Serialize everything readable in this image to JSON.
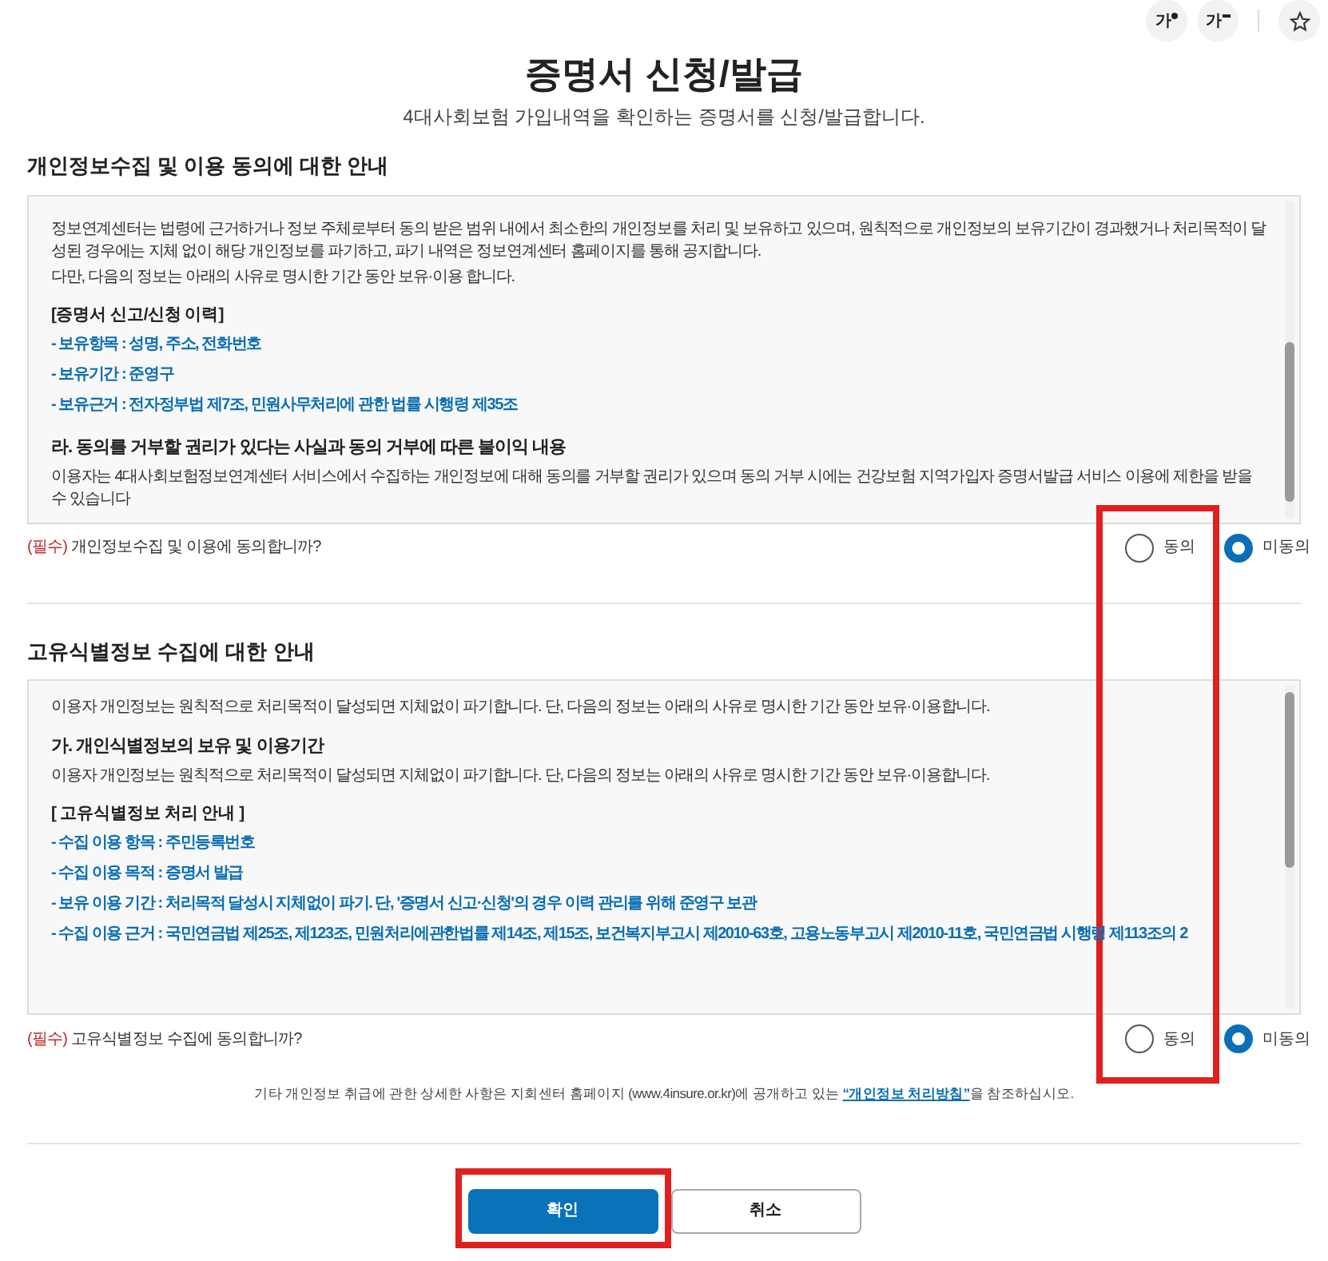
{
  "tools": [
    {
      "label": "가",
      "kind": "font-up"
    },
    {
      "label": "가",
      "kind": "font-down"
    },
    {
      "kind": "favorite"
    }
  ],
  "title": "증명서 신청/발급",
  "subtitle": "4대사회보험 가입내역을 확인하는 증명서를 신청/발급합니다.",
  "sections": [
    {
      "title": "개인정보수집 및 이용 동의에 대한 안내",
      "content": [
        {
          "kind": "para",
          "text": "정보연계센터는 법령에 근거하거나 정보 주체로부터 동의 받은 범위 내에서 최소한의 개인정보를 처리 및 보유하고 있으며, 원칙적으로 개인정보의 보유기간이 경과했거나 처리목적이 달성된 경우에는 지체 없이 해당 개인정보를 파기하고, 파기 내역은 정보연계센터 홈페이지를 통해 공지합니다."
        },
        {
          "kind": "para",
          "text": "다만, 다음의 정보는 아래의 사유로 명시한 기간 동안 보유·이용 합니다."
        },
        {
          "kind": "bracket",
          "text": "[증명서 신고/신청 이력]"
        },
        {
          "kind": "item",
          "text": "- 보유항목 : 성명, 주소, 전화번호"
        },
        {
          "kind": "item",
          "text": "- 보유기간 : 준영구"
        },
        {
          "kind": "item",
          "text": "- 보유근거 : 전자정부법 제7조, 민원사무처리에 관한 법률 시행령 제35조"
        },
        {
          "kind": "heading",
          "text": "라. 동의를 거부할 권리가 있다는 사실과 동의 거부에 따른 불이익 내용"
        },
        {
          "kind": "para",
          "text": "이용자는 4대사회보험정보연계센터 서비스에서 수집하는 개인정보에 대해 동의를 거부할 권리가 있으며 동의 거부 시에는 건강보험 지역가입자 증명서발급 서비스 이용에 제한을 받을 수 있습니다"
        }
      ],
      "required": "(필수)",
      "question": "개인정보수집 및 이용에 동의합니까?",
      "options": [
        {
          "label": "동의",
          "selected": false
        },
        {
          "label": "미동의",
          "selected": true
        }
      ]
    },
    {
      "title": "고유식별정보 수집에 대한 안내",
      "content": [
        {
          "kind": "para",
          "text": "이용자 개인정보는 원칙적으로 처리목적이 달성되면 지체없이 파기합니다. 단, 다음의 정보는 아래의 사유로 명시한 기간 동안 보유·이용합니다."
        },
        {
          "kind": "heading",
          "text": "가. 개인식별정보의 보유 및 이용기간"
        },
        {
          "kind": "para",
          "text": "이용자 개인정보는 원칙적으로 처리목적이 달성되면 지체없이 파기합니다. 단, 다음의 정보는 아래의 사유로 명시한 기간 동안 보유·이용합니다."
        },
        {
          "kind": "bracket",
          "text": "[ 고유식별정보 처리 안내 ]"
        },
        {
          "kind": "item",
          "text": "- 수집 이용 항목 : 주민등록번호"
        },
        {
          "kind": "item",
          "text": "- 수집 이용 목적 : 증명서 발급"
        },
        {
          "kind": "item",
          "text": "- 보유 이용 기간 : 처리목적 달성시 지체없이 파기. 단, '증명서 신고·신청'의 경우 이력 관리를 위해 준영구 보관"
        },
        {
          "kind": "item",
          "text": "- 수집 이용 근거 : 국민연금법 제25조, 제123조, 민원처리에관한법률 제14조, 제15조, 보건복지부고시 제2010-63호, 고용노동부고시 제2010-11호, 국민연금법 시행령 제113조의 2"
        }
      ],
      "required": "(필수)",
      "question": "고유식별정보 수집에 동의합니까?",
      "options": [
        {
          "label": "동의",
          "selected": false
        },
        {
          "label": "미동의",
          "selected": true
        }
      ]
    }
  ],
  "note": {
    "before": "기타 개인정보 취급에 관한 상세한 사항은 지회센터 홈페이지 (www.4insure.or.kr)에 공개하고 있는 ",
    "link": "“개인정보 처리방침”",
    "after": "을 참조하십시오."
  },
  "buttons": [
    {
      "label": "확인",
      "kind": "primary"
    },
    {
      "label": "취소",
      "kind": "secondary"
    }
  ],
  "highlight_frames": {
    "consent_column": true,
    "confirm_button": true
  }
}
